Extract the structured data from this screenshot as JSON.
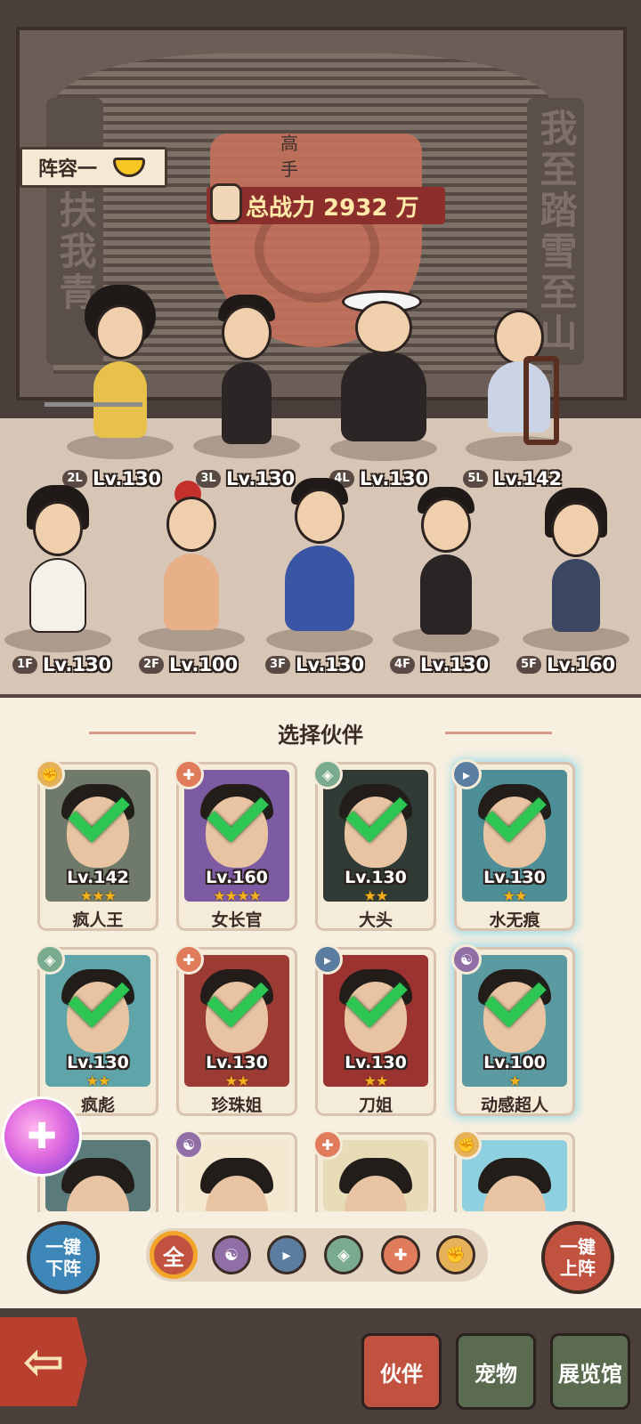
{
  "lineup": {
    "label": "阵容一"
  },
  "power": {
    "label": "总战力 2932 万"
  },
  "wall": {
    "left_scroll": "无扶我青",
    "right_scroll": "我至踏雪至山",
    "emblem_text": "高 手"
  },
  "back_row": [
    {
      "pos": "2L",
      "lv": "Lv.130"
    },
    {
      "pos": "3L",
      "lv": "Lv.130"
    },
    {
      "pos": "4L",
      "lv": "Lv.130"
    },
    {
      "pos": "5L",
      "lv": "Lv.142"
    }
  ],
  "front_row": [
    {
      "pos": "1F",
      "lv": "Lv.130"
    },
    {
      "pos": "2F",
      "lv": "Lv.100"
    },
    {
      "pos": "3F",
      "lv": "Lv.130"
    },
    {
      "pos": "4F",
      "lv": "Lv.130"
    },
    {
      "pos": "5F",
      "lv": "Lv.160"
    }
  ],
  "panel": {
    "title": "选择伙伴"
  },
  "cards": [
    {
      "name": "疯人王",
      "lv": "Lv.142",
      "stars": "★★★",
      "type": "fist-icon",
      "bg": "#6f7a6a"
    },
    {
      "name": "女长官",
      "lv": "Lv.160",
      "stars": "★★★★",
      "type": "heal-icon",
      "bg": "#7d5ba3"
    },
    {
      "name": "大头",
      "lv": "Lv.130",
      "stars": "★★",
      "type": "shield-icon",
      "bg": "#2f3b34"
    },
    {
      "name": "水无痕",
      "lv": "Lv.130",
      "stars": "★★",
      "type": "gun-icon",
      "bg": "#4e8e96"
    },
    {
      "name": "疯彪",
      "lv": "Lv.130",
      "stars": "★★",
      "type": "shield-icon",
      "bg": "#5fa4a8"
    },
    {
      "name": "珍珠姐",
      "lv": "Lv.130",
      "stars": "★★",
      "type": "heal-icon",
      "bg": "#9c3a34"
    },
    {
      "name": "刀姐",
      "lv": "Lv.130",
      "stars": "★★",
      "type": "gun-icon",
      "bg": "#9b3430"
    },
    {
      "name": "动感超人",
      "lv": "Lv.100",
      "stars": "★",
      "type": "yinyang-icon",
      "bg": "#5a9aa0"
    }
  ],
  "partial_cards": [
    {
      "type": "",
      "bg": "#5b7a7a"
    },
    {
      "type": "yinyang-icon",
      "bg": "#f4e8d0"
    },
    {
      "type": "heal-icon",
      "bg": "#e8dcb8"
    },
    {
      "type": "fist-icon",
      "bg": "#8fd0e0"
    }
  ],
  "buttons": {
    "unequip_all": "一键\n下阵",
    "equip_all": "一键\n上阵"
  },
  "filters": {
    "all": "全"
  },
  "nav": {
    "partner": "伙伴",
    "pet": "宠物",
    "gallery": "展览馆"
  }
}
